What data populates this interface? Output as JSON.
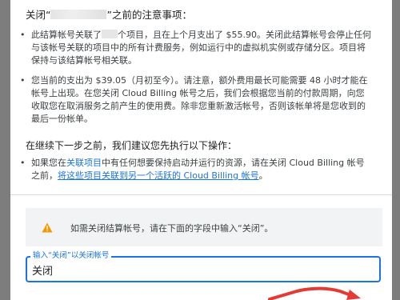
{
  "dialog": {
    "title_prefix": "关闭“",
    "title_suffix": "”之前的注意事项：",
    "notices": [
      {
        "part1": "此结算帐号关联了",
        "part2": "个项目，且在上个月支出了 $55.90。关闭此结算帐号会停止任何与该帐号关联的项目中的所有计费服务，例如运行中的虚拟机实例或存储分区。项目将保持与该结算帐号相关联。"
      },
      {
        "text": "您当前的支出为 $39.05（月初至今）。请注意，额外费用最长可能需要 48 小时才能在帐号上出现。在您关闭 Cloud Billing 帐号之后，我们会根据您当前的付款周期，向您收取您在取消服务之前产生的使用费。除非您重新激活帐号，否则该帐单将是您收到的最后一份帐单。"
      }
    ],
    "recommend_heading": "在继续下一步之前，我们建议您先执行以下操作：",
    "recommend": {
      "part1": "如果您在",
      "link1": "关联项目",
      "part2": "中有任何想要保持启动并运行的资源，请在关闭 Cloud Billing 帐号之前，",
      "link2": "将这些项目关联到另一个活跃的 Cloud Billing 帐号",
      "part3": "。"
    },
    "warning_text": "如需关闭结算帐号，请在下面的字段中输入“关闭”。",
    "input": {
      "label": "输入“关闭”以关闭帐号",
      "value": "关闭"
    }
  },
  "colors": {
    "accent": "#1a73e8",
    "warning_icon": "#f29900",
    "annotation_arrow": "#e53935"
  },
  "icons": [
    "warning-icon"
  ]
}
